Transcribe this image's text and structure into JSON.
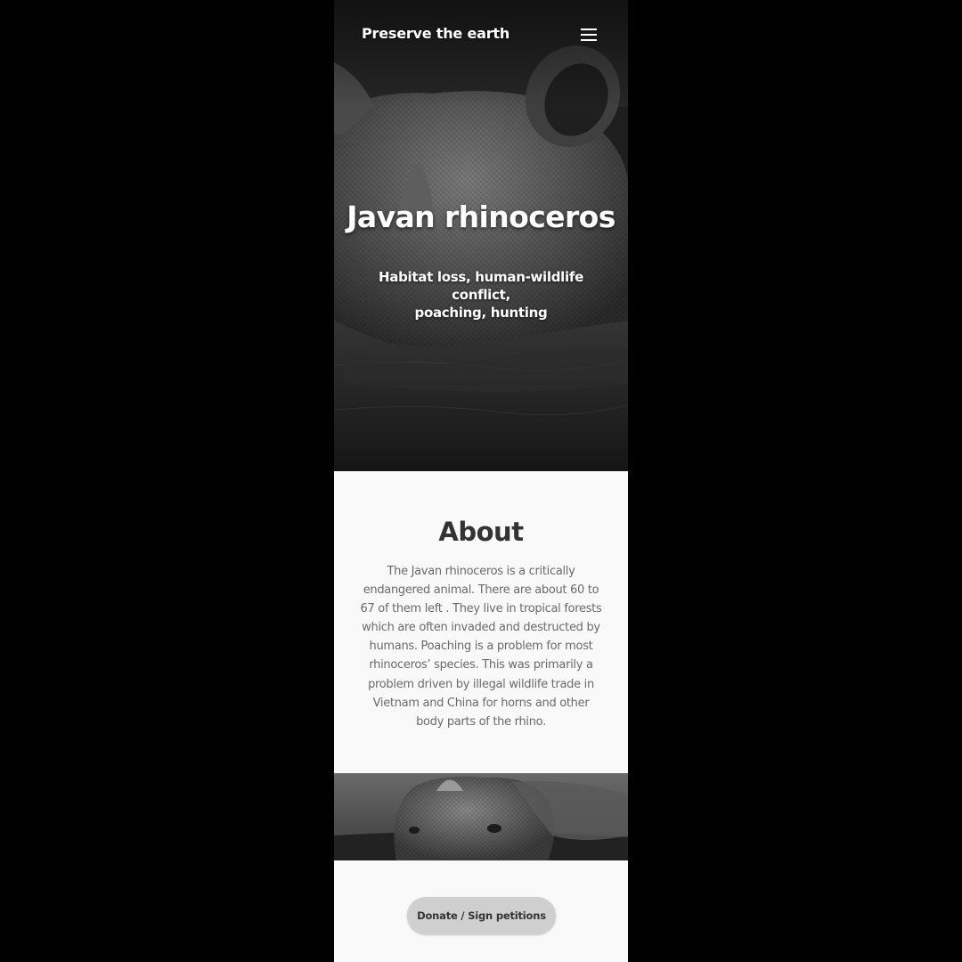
{
  "nav": {
    "brand": "Preserve the earth",
    "menu_icon": "hamburger-menu-icon"
  },
  "hero": {
    "title": "Javan rhinoceros",
    "subtitle_line1": "Habitat loss, human-wildlife conflict,",
    "subtitle_line2": "poaching, hunting",
    "image": "rhinoceros-in-water-photo"
  },
  "about": {
    "title": "About",
    "lines": [
      "The Javan rhinoceros is a critically",
      "endangered animal. There are about 60 to",
      "67 of them left . They live in tropical forests",
      "which are often invaded and destructed by",
      "humans. Poaching is a problem for most",
      "rhinoceros’ species. This was primarily a",
      "problem driven by illegal wildlife trade in",
      "Vietnam and China for horns and other",
      "body parts of the rhino."
    ]
  },
  "strip_image": "rhinoceros-head-in-water-photo",
  "cta": {
    "donate_label": "Donate / Sign petitions"
  },
  "colors": {
    "page_background": "#000000",
    "content_background": "#f9f9f9",
    "heading": "#333333",
    "body_text": "#6a6a6a",
    "button_background": "#cfcfcf"
  }
}
